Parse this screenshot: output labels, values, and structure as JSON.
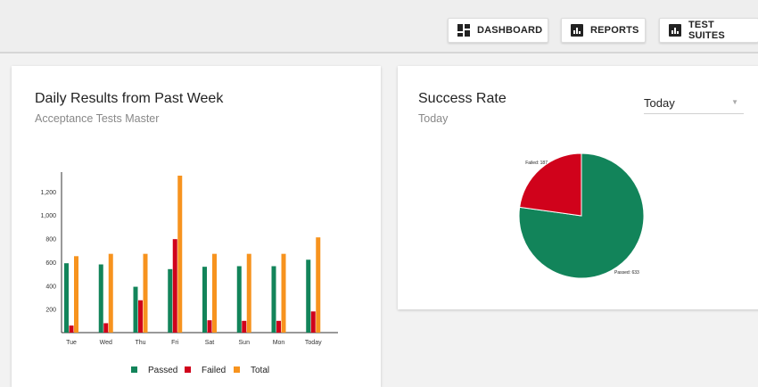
{
  "toolbar": {
    "buttons": [
      {
        "label": "DASHBOARD",
        "icon": "dashboard-icon"
      },
      {
        "label": "REPORTS",
        "icon": "bar-chart-icon"
      },
      {
        "label": "TEST SUITES",
        "icon": "bar-chart-icon"
      }
    ]
  },
  "daily": {
    "title": "Daily Results from Past Week",
    "subtitle": "Acceptance Tests Master"
  },
  "success": {
    "title": "Success Rate",
    "subtitle": "Today",
    "select": {
      "value": "Today"
    }
  },
  "colors": {
    "passed": "#12845a",
    "failed": "#d0021b",
    "total": "#f7931e"
  },
  "chart_data": [
    {
      "type": "bar",
      "categories": [
        "Tue",
        "Wed",
        "Thu",
        "Fri",
        "Sat",
        "Sun",
        "Mon",
        "Today"
      ],
      "series": [
        {
          "name": "Passed",
          "values": [
            590,
            580,
            390,
            540,
            560,
            565,
            565,
            620
          ]
        },
        {
          "name": "Failed",
          "values": [
            60,
            80,
            275,
            795,
            105,
            100,
            100,
            180
          ]
        },
        {
          "name": "Total",
          "values": [
            650,
            670,
            670,
            1335,
            670,
            670,
            670,
            810
          ]
        }
      ],
      "ylim": [
        0,
        1350
      ],
      "yticks": [
        200,
        400,
        600,
        800,
        "1,000",
        "1,200"
      ],
      "legend_position": "bottom"
    },
    {
      "type": "pie",
      "slices": [
        {
          "label": "Passed",
          "value": 633,
          "display": "Passed: 633"
        },
        {
          "label": "Failed",
          "value": 187,
          "display": "Failed: 187"
        }
      ]
    }
  ]
}
